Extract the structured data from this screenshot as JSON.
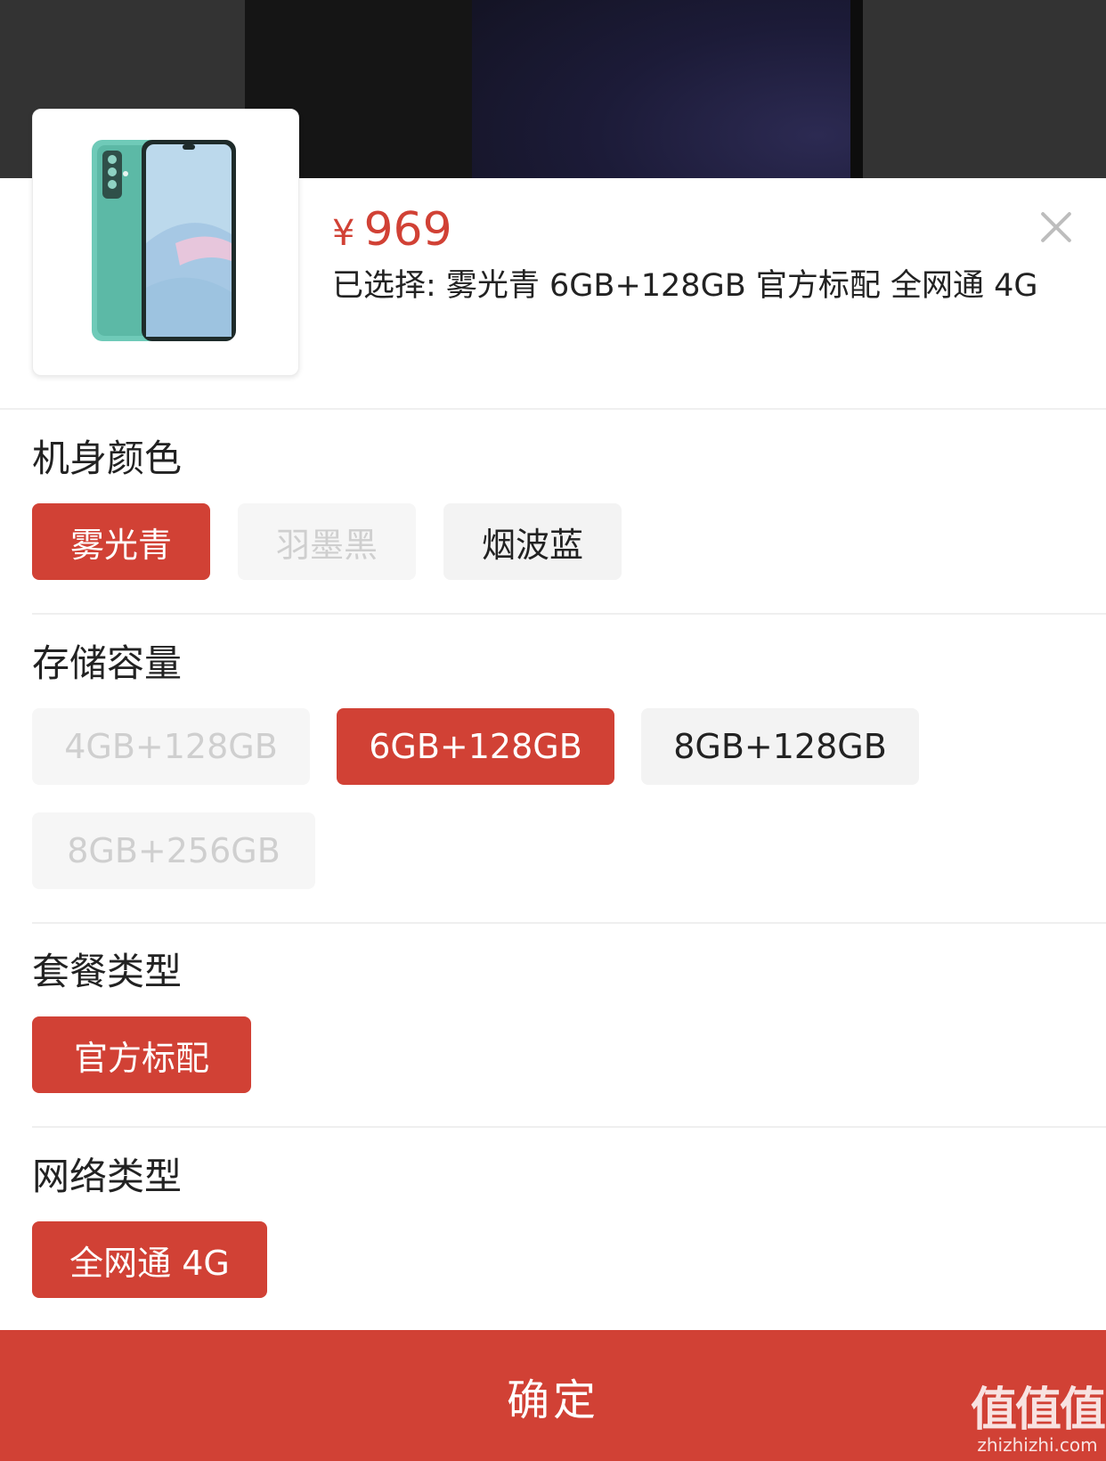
{
  "product": {
    "price_symbol": "¥",
    "price": "969",
    "selected_summary": "已选择: 雾光青 6GB+128GB 官方标配 全网通 4G"
  },
  "sections": [
    {
      "title": "机身颜色",
      "options": [
        {
          "label": "雾光青",
          "state": "selected"
        },
        {
          "label": "羽墨黑",
          "state": "disabled"
        },
        {
          "label": "烟波蓝",
          "state": "normal"
        }
      ]
    },
    {
      "title": "存储容量",
      "options": [
        {
          "label": "4GB+128GB",
          "state": "disabled"
        },
        {
          "label": "6GB+128GB",
          "state": "selected"
        },
        {
          "label": "8GB+128GB",
          "state": "normal"
        },
        {
          "label": "8GB+256GB",
          "state": "disabled"
        }
      ]
    },
    {
      "title": "套餐类型",
      "options": [
        {
          "label": "官方标配",
          "state": "selected"
        }
      ]
    },
    {
      "title": "网络类型",
      "options": [
        {
          "label": "全网通 4G",
          "state": "selected"
        }
      ]
    }
  ],
  "confirm_label": "确定",
  "watermark": {
    "main": "值值值",
    "url": "zhizhizhi.com"
  },
  "colors": {
    "accent": "#d14135",
    "option_bg": "#f3f3f3",
    "disabled_text": "#cfcfcf"
  },
  "icons": {
    "close": "close-icon",
    "product": "phone-thumbnail"
  }
}
